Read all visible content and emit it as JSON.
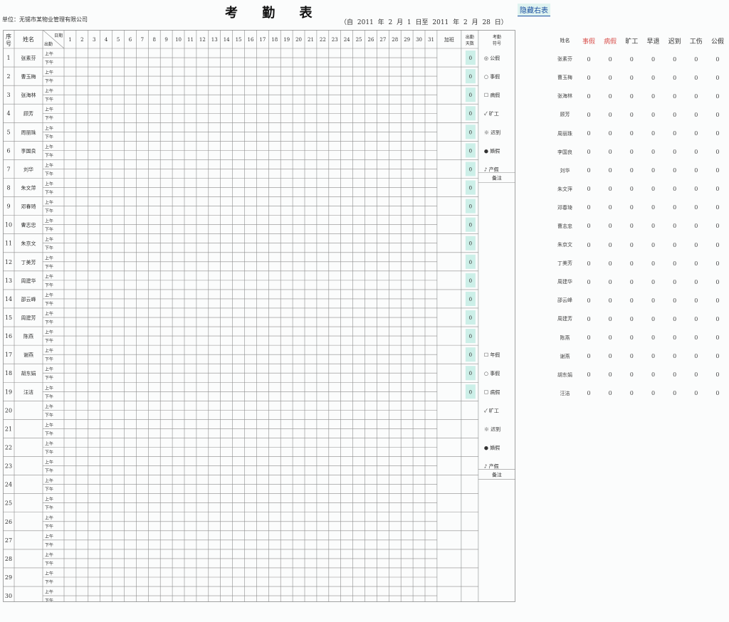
{
  "header": {
    "title": "考 勤 表",
    "unit": "单位：无锡市某物业管理有限公司",
    "period": "（自 2011 年 2 月 1 日至 2011 年 2 月 28 日）",
    "hide_button": "隐藏右表"
  },
  "table": {
    "headers": {
      "seq": "序号",
      "name": "姓名",
      "date_label": "日期",
      "shift_label": "出勤",
      "total_label": "出勤天数",
      "symbol_label": "考勤符号",
      "extra_label": "加班"
    },
    "days": [
      "1",
      "2",
      "3",
      "4",
      "5",
      "6",
      "7",
      "8",
      "9",
      "10",
      "11",
      "12",
      "13",
      "14",
      "15",
      "16",
      "17",
      "18",
      "19",
      "20",
      "21",
      "22",
      "23",
      "24",
      "25",
      "26",
      "27",
      "28",
      "29",
      "30",
      "31"
    ],
    "halves": [
      "上午",
      "下午"
    ],
    "rows": [
      {
        "seq": "1",
        "name": "张素芬",
        "total": "0"
      },
      {
        "seq": "2",
        "name": "曹玉梅",
        "total": "0"
      },
      {
        "seq": "3",
        "name": "张海林",
        "total": "0"
      },
      {
        "seq": "4",
        "name": "顾芳",
        "total": "0"
      },
      {
        "seq": "5",
        "name": "周丽珠",
        "total": "0"
      },
      {
        "seq": "6",
        "name": "李国良",
        "total": "0"
      },
      {
        "seq": "7",
        "name": "刘华",
        "total": "0"
      },
      {
        "seq": "8",
        "name": "朱文萍",
        "total": "0"
      },
      {
        "seq": "9",
        "name": "邓春琦",
        "total": "0"
      },
      {
        "seq": "10",
        "name": "曹志忠",
        "total": "0"
      },
      {
        "seq": "11",
        "name": "朱京文",
        "total": "0"
      },
      {
        "seq": "12",
        "name": "丁美芳",
        "total": "0"
      },
      {
        "seq": "13",
        "name": "周建华",
        "total": "0"
      },
      {
        "seq": "14",
        "name": "邵云峰",
        "total": "0"
      },
      {
        "seq": "15",
        "name": "周建芳",
        "total": "0"
      },
      {
        "seq": "16",
        "name": "陈燕",
        "total": "0"
      },
      {
        "seq": "17",
        "name": "谢燕",
        "total": "0"
      },
      {
        "seq": "18",
        "name": "胡东娟",
        "total": "0"
      },
      {
        "seq": "19",
        "name": "汪洁",
        "total": "0"
      },
      {
        "seq": "20",
        "name": "",
        "total": ""
      },
      {
        "seq": "21",
        "name": "",
        "total": ""
      },
      {
        "seq": "22",
        "name": "",
        "total": ""
      },
      {
        "seq": "23",
        "name": "",
        "total": ""
      },
      {
        "seq": "24",
        "name": "",
        "total": ""
      },
      {
        "seq": "25",
        "name": "",
        "total": ""
      },
      {
        "seq": "26",
        "name": "",
        "total": ""
      },
      {
        "seq": "27",
        "name": "",
        "total": ""
      },
      {
        "seq": "28",
        "name": "",
        "total": ""
      },
      {
        "seq": "29",
        "name": "",
        "total": ""
      },
      {
        "seq": "30",
        "name": "",
        "total": ""
      }
    ],
    "legend_groups": [
      {
        "items": [
          "◎ 公假",
          "○ 事假",
          "☐ 病假",
          "✓ 旷工",
          "※ 迟到",
          "● 婚假",
          "♪ 产假"
        ],
        "note": "备注"
      },
      {
        "items": [
          "☐ 年假",
          "○ 事假",
          "☐ 病假",
          "✓ 旷工",
          "※ 迟到",
          "● 婚假",
          "♪ 产假"
        ],
        "note": "备注"
      }
    ],
    "colors": {
      "highlight": "#ccefe8",
      "grid": "#8d8d8d"
    }
  },
  "summary": {
    "headers": [
      {
        "label": "姓名",
        "color": "#333333"
      },
      {
        "label": "事假",
        "color": "#d9534f"
      },
      {
        "label": "病假",
        "color": "#d9534f"
      },
      {
        "label": "旷工",
        "color": "#333333"
      },
      {
        "label": "早退",
        "color": "#333333"
      },
      {
        "label": "迟到",
        "color": "#333333"
      },
      {
        "label": "工伤",
        "color": "#333333"
      },
      {
        "label": "公假",
        "color": "#333333"
      }
    ],
    "rows": [
      {
        "name": "张素芬",
        "values": [
          "0",
          "0",
          "0",
          "0",
          "0",
          "0",
          "0"
        ]
      },
      {
        "name": "曹玉梅",
        "values": [
          "0",
          "0",
          "0",
          "0",
          "0",
          "0",
          "0"
        ]
      },
      {
        "name": "张海林",
        "values": [
          "0",
          "0",
          "0",
          "0",
          "0",
          "0",
          "0"
        ]
      },
      {
        "name": "顾芳",
        "values": [
          "0",
          "0",
          "0",
          "0",
          "0",
          "0",
          "0"
        ]
      },
      {
        "name": "周丽珠",
        "values": [
          "0",
          "0",
          "0",
          "0",
          "0",
          "0",
          "0"
        ]
      },
      {
        "name": "李国良",
        "values": [
          "0",
          "0",
          "0",
          "0",
          "0",
          "0",
          "0"
        ]
      },
      {
        "name": "刘华",
        "values": [
          "0",
          "0",
          "0",
          "0",
          "0",
          "0",
          "0"
        ]
      },
      {
        "name": "朱文萍",
        "values": [
          "0",
          "0",
          "0",
          "0",
          "0",
          "0",
          "0"
        ]
      },
      {
        "name": "邓春琦",
        "values": [
          "0",
          "0",
          "0",
          "0",
          "0",
          "0",
          "0"
        ]
      },
      {
        "name": "曹志忠",
        "values": [
          "0",
          "0",
          "0",
          "0",
          "0",
          "0",
          "0"
        ]
      },
      {
        "name": "朱京文",
        "values": [
          "0",
          "0",
          "0",
          "0",
          "0",
          "0",
          "0"
        ]
      },
      {
        "name": "丁美芳",
        "values": [
          "0",
          "0",
          "0",
          "0",
          "0",
          "0",
          "0"
        ]
      },
      {
        "name": "周建华",
        "values": [
          "0",
          "0",
          "0",
          "0",
          "0",
          "0",
          "0"
        ]
      },
      {
        "name": "邵云峰",
        "values": [
          "0",
          "0",
          "0",
          "0",
          "0",
          "0",
          "0"
        ]
      },
      {
        "name": "周建芳",
        "values": [
          "0",
          "0",
          "0",
          "0",
          "0",
          "0",
          "0"
        ]
      },
      {
        "name": "陈燕",
        "values": [
          "0",
          "0",
          "0",
          "0",
          "0",
          "0",
          "0"
        ]
      },
      {
        "name": "谢燕",
        "values": [
          "0",
          "0",
          "0",
          "0",
          "0",
          "0",
          "0"
        ]
      },
      {
        "name": "胡东娟",
        "values": [
          "0",
          "0",
          "0",
          "0",
          "0",
          "0",
          "0"
        ]
      },
      {
        "name": "汪洁",
        "values": [
          "0",
          "0",
          "0",
          "0",
          "0",
          "0",
          "0"
        ]
      }
    ]
  }
}
